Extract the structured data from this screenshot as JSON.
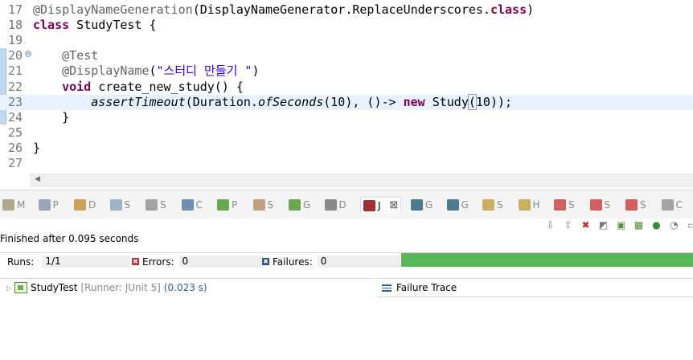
{
  "editor": {
    "lines": [
      {
        "num": "17",
        "parts": [
          {
            "t": "@DisplayNameGeneration",
            "c": "anno"
          },
          {
            "t": "(DisplayNameGenerator.ReplaceUnderscores."
          },
          {
            "t": "class",
            "c": "kw"
          },
          {
            "t": ")"
          }
        ]
      },
      {
        "num": "18",
        "parts": [
          {
            "t": "class",
            "c": "kw"
          },
          {
            "t": " StudyTest {"
          }
        ]
      },
      {
        "num": "19",
        "parts": []
      },
      {
        "num": "20",
        "parts": [
          {
            "t": "    "
          },
          {
            "t": "@Test",
            "c": "anno"
          }
        ]
      },
      {
        "num": "21",
        "parts": [
          {
            "t": "    "
          },
          {
            "t": "@DisplayName",
            "c": "anno"
          },
          {
            "t": "("
          },
          {
            "t": "\"스터디 만들기 \"",
            "c": "str"
          },
          {
            "t": ")"
          }
        ]
      },
      {
        "num": "22",
        "parts": [
          {
            "t": "    "
          },
          {
            "t": "void",
            "c": "kw"
          },
          {
            "t": " create_new_study() {"
          }
        ]
      },
      {
        "num": "23",
        "parts": [
          {
            "t": "        "
          },
          {
            "t": "assertTimeout",
            "c": "it"
          },
          {
            "t": "(Duration."
          },
          {
            "t": "ofSeconds",
            "c": "it"
          },
          {
            "t": "(10), ()-> "
          },
          {
            "t": "new",
            "c": "kw"
          },
          {
            "t": " Study"
          },
          {
            "t": "(",
            "c": "bracket"
          },
          {
            "t": "10));"
          }
        ]
      },
      {
        "num": "24",
        "parts": [
          {
            "t": "    }"
          }
        ]
      },
      {
        "num": "25",
        "parts": []
      },
      {
        "num": "26",
        "parts": [
          {
            "t": "}"
          }
        ]
      },
      {
        "num": "27",
        "parts": []
      }
    ],
    "current_line": "23",
    "fold_glyph": "⊖",
    "scroll_left": "◀"
  },
  "view_tabs": [
    {
      "label": "M",
      "icon": "markers-icon",
      "color": "#b0a890"
    },
    {
      "label": "P",
      "icon": "properties-icon",
      "color": "#9aa6b8"
    },
    {
      "label": "D",
      "icon": "data-source-explorer-icon",
      "color": "#c9a35a"
    },
    {
      "label": "S",
      "icon": "snippets-icon",
      "color": "#9db3c9"
    },
    {
      "label": "S",
      "icon": "search-icon",
      "color": "#a3a3a3"
    },
    {
      "label": "C",
      "icon": "console-icon",
      "color": "#6f8fb3"
    },
    {
      "label": "P",
      "icon": "progress-icon",
      "color": "#6aa84f"
    },
    {
      "label": "S",
      "icon": "servers-icon",
      "color": "#c0a080"
    },
    {
      "label": "G",
      "icon": "git-staging-icon",
      "color": "#6aa84f"
    },
    {
      "label": "D",
      "icon": "debug-icon",
      "color": "#8a8a8a"
    },
    {
      "label": "J",
      "icon": "junit-icon",
      "color": "#a03030",
      "active": true
    },
    {
      "label": "G",
      "icon": "gradle-tasks-icon",
      "color": "#4d7a8c"
    },
    {
      "label": "G",
      "icon": "gradle-executions-icon",
      "color": "#4d7a8c"
    },
    {
      "label": "S",
      "icon": "spring-symbols-icon",
      "color": "#c8b060"
    },
    {
      "label": "H",
      "icon": "history-icon",
      "color": "#c8b060"
    },
    {
      "label": "S",
      "icon": "sonar-issues-icon",
      "color": "#d06060"
    },
    {
      "label": "S",
      "icon": "sonar-rules-icon",
      "color": "#d06060"
    },
    {
      "label": "S",
      "icon": "sonar-report-icon",
      "color": "#d06060"
    },
    {
      "label": "C",
      "icon": "coverage-icon",
      "color": "#a3a3a3"
    }
  ],
  "view_close_glyph": "⊠",
  "junit_toolbar": [
    {
      "name": "next-failure-icon",
      "glyph": "⇩",
      "color": "#8a8a8a"
    },
    {
      "name": "previous-failure-icon",
      "glyph": "⇧",
      "color": "#8a8a8a"
    },
    {
      "name": "show-failures-only-icon",
      "glyph": "✖",
      "color": "#c03030"
    },
    {
      "name": "scroll-lock-icon",
      "glyph": "◩",
      "color": "#7a7a7a"
    },
    {
      "name": "rerun-test-icon",
      "glyph": "▣",
      "color": "#5a8a3a"
    },
    {
      "name": "rerun-failed-first-icon",
      "glyph": "▦",
      "color": "#5a8a3a"
    },
    {
      "name": "stop-icon",
      "glyph": "●",
      "color": "#3a8a3a"
    },
    {
      "name": "test-run-history-icon",
      "glyph": "◔",
      "color": "#7a7a7a"
    },
    {
      "name": "view-menu-icon",
      "glyph": "▭",
      "color": "#7a7a7a"
    }
  ],
  "status": "Finished after 0.095 seconds",
  "counters": {
    "runs_label": "Runs:",
    "runs_value": "1/1",
    "errors_label": "Errors:",
    "errors_value": "0",
    "failures_label": "Failures:",
    "failures_value": "0",
    "error_mark": "✖",
    "failure_mark": "✖",
    "error_color": "#c03030",
    "failure_color": "#2d4f8a",
    "progress_fraction": 1.0,
    "progress_color": "#5bb75b"
  },
  "tree": {
    "expander": "▷",
    "name": "StudyTest",
    "runner": "[Runner: JUnit 5]",
    "duration": "(0.023 s)"
  },
  "failure_trace": {
    "title": "Failure Trace"
  }
}
